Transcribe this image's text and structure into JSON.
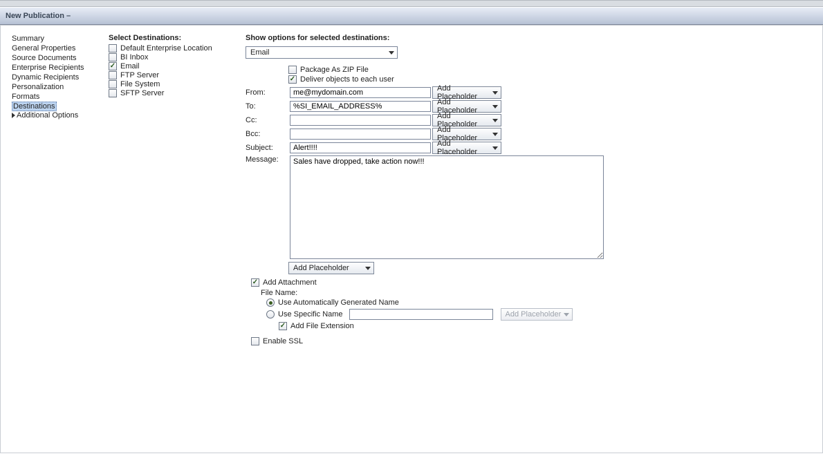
{
  "window": {
    "title": "New Publication –"
  },
  "nav": {
    "items": [
      {
        "label": "Summary"
      },
      {
        "label": "General Properties"
      },
      {
        "label": "Source Documents"
      },
      {
        "label": "Enterprise Recipients"
      },
      {
        "label": "Dynamic Recipients"
      },
      {
        "label": "Personalization"
      },
      {
        "label": "Formats"
      },
      {
        "label": "Destinations",
        "selected": true
      }
    ],
    "sub_label": "Additional Options"
  },
  "destinations": {
    "heading": "Select Destinations:",
    "items": [
      {
        "label": "Default Enterprise Location",
        "checked": false
      },
      {
        "label": "BI Inbox",
        "checked": false
      },
      {
        "label": "Email",
        "checked": true
      },
      {
        "label": "FTP Server",
        "checked": false
      },
      {
        "label": "File System",
        "checked": false
      },
      {
        "label": "SFTP Server",
        "checked": false
      }
    ]
  },
  "options": {
    "heading": "Show options for selected destinations:",
    "selected_destination": "Email",
    "package_zip": {
      "label": "Package As ZIP File",
      "checked": false
    },
    "deliver_each": {
      "label": "Deliver objects to each user",
      "checked": true
    },
    "from": {
      "label": "From:",
      "value": "me@mydomain.com"
    },
    "to": {
      "label": "To:",
      "value": "%SI_EMAIL_ADDRESS%"
    },
    "cc": {
      "label": "Cc:",
      "value": ""
    },
    "bcc": {
      "label": "Bcc:",
      "value": ""
    },
    "subject": {
      "label": "Subject:",
      "value": "Alert!!!!"
    },
    "message": {
      "label": "Message:",
      "value": "Sales have dropped, take action now!!!"
    },
    "add_placeholder_label": "Add Placeholder",
    "add_attachment": {
      "label": "Add Attachment",
      "checked": true
    },
    "file_name_label": "File Name:",
    "auto_name": {
      "label": "Use Automatically Generated Name",
      "selected": true
    },
    "specific_name": {
      "label": "Use Specific Name",
      "selected": false,
      "value": ""
    },
    "add_file_ext": {
      "label": "Add File Extension",
      "checked": true
    },
    "enable_ssl": {
      "label": "Enable SSL",
      "checked": false
    }
  }
}
